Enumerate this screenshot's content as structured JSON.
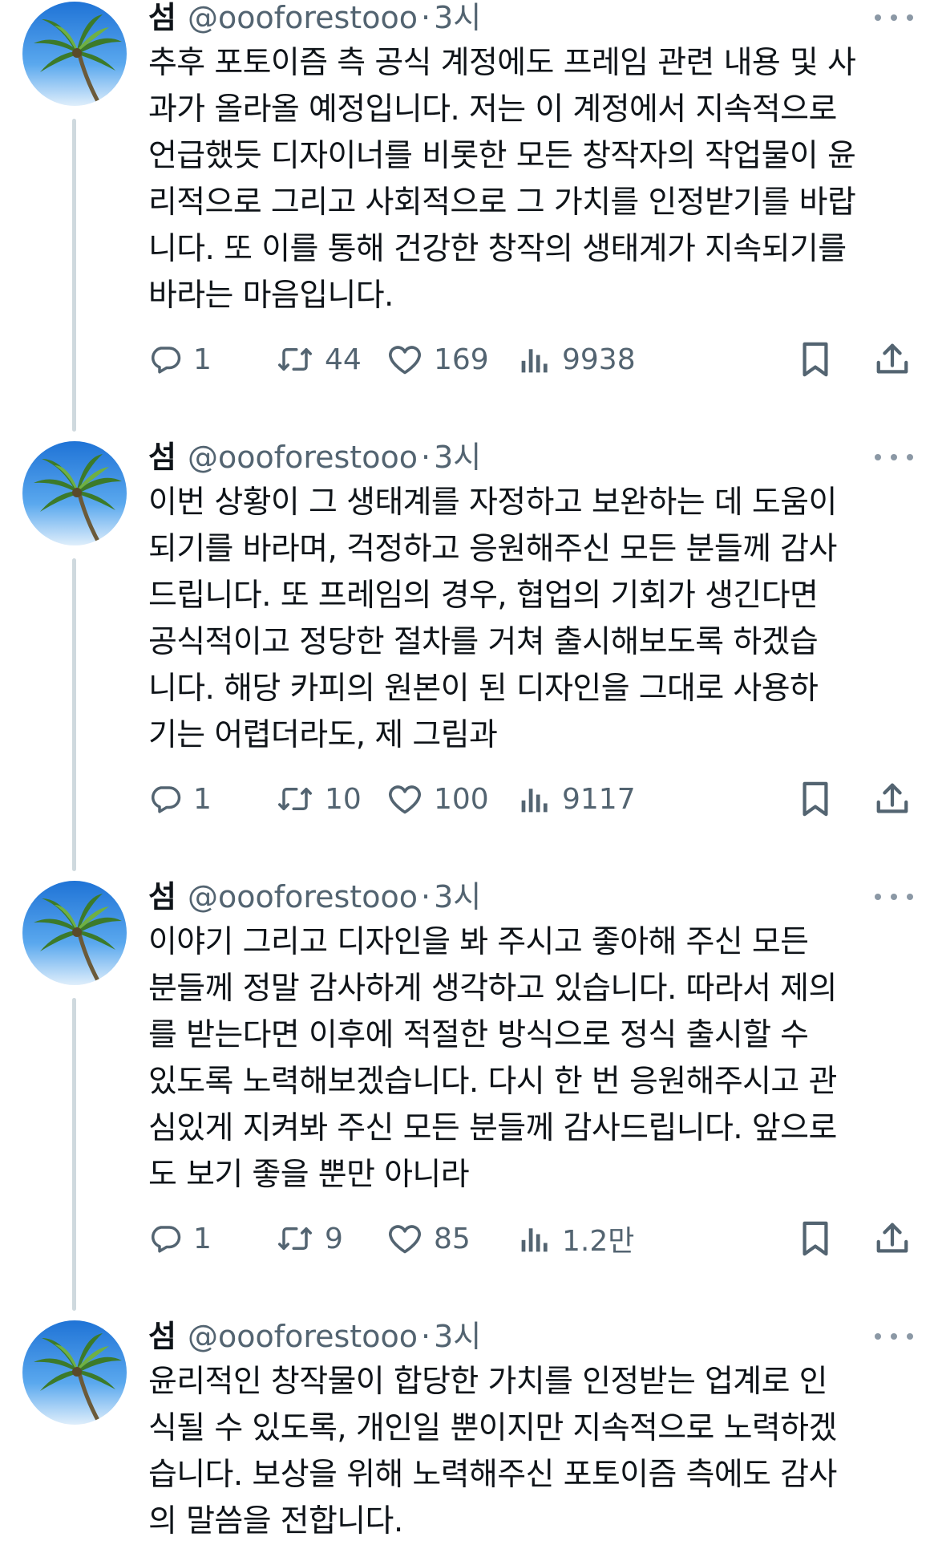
{
  "colors": {
    "text_primary": "#0f1419",
    "text_secondary": "#536471",
    "thread_line": "#cfd9de",
    "background": "#ffffff"
  },
  "icons": {
    "reply": "reply-icon",
    "retweet": "retweet-icon",
    "like": "heart-icon",
    "views": "bar-chart-icon",
    "bookmark": "bookmark-icon",
    "share": "share-icon",
    "more": "more-horizontal-icon",
    "avatar": "palm-tree-avatar"
  },
  "tweets": [
    {
      "author": {
        "name": "섬",
        "handle": "@oooforestooo"
      },
      "separator": "·",
      "time": "3시",
      "text": "추후 포토이즘 측 공식 계정에도 프레임 관련 내용 및 사\n과가 올라올 예정입니다. 저는 이 계정에서 지속적으로\n언급했듯 디자이너를 비롯한 모든 창작자의 작업물이 윤\n리적으로 그리고 사회적으로 그 가치를 인정받기를 바랍\n니다. 또 이를 통해 건강한 창작의 생태계가 지속되기를\n바라는 마음입니다.",
      "stats": {
        "replies": "1",
        "retweets": "44",
        "likes": "169",
        "views": "9938"
      }
    },
    {
      "author": {
        "name": "섬",
        "handle": "@oooforestooo"
      },
      "separator": "·",
      "time": "3시",
      "text": "이번 상황이 그 생태계를 자정하고 보완하는 데 도움이\n되기를 바라며, 걱정하고 응원해주신 모든 분들께 감사\n드립니다. 또 프레임의 경우, 협업의 기회가 생긴다면\n공식적이고 정당한 절차를 거쳐 출시해보도록 하겠습\n니다. 해당 카피의 원본이 된 디자인을 그대로 사용하\n기는 어렵더라도, 제 그림과",
      "stats": {
        "replies": "1",
        "retweets": "10",
        "likes": "100",
        "views": "9117"
      }
    },
    {
      "author": {
        "name": "섬",
        "handle": "@oooforestooo"
      },
      "separator": "·",
      "time": "3시",
      "text": "이야기 그리고 디자인을 봐 주시고 좋아해 주신 모든\n분들께 정말 감사하게 생각하고 있습니다. 따라서 제의\n를 받는다면 이후에 적절한 방식으로 정식 출시할 수\n있도록 노력해보겠습니다. 다시 한 번 응원해주시고 관\n심있게 지켜봐 주신 모든 분들께 감사드립니다. 앞으로\n도 보기 좋을 뿐만 아니라",
      "stats": {
        "replies": "1",
        "retweets": "9",
        "likes": "85",
        "views": "1.2만"
      }
    },
    {
      "author": {
        "name": "섬",
        "handle": "@oooforestooo"
      },
      "separator": "·",
      "time": "3시",
      "text": "윤리적인 창작물이 합당한 가치를 인정받는 업계로 인\n식될 수 있도록, 개인일 뿐이지만 지속적으로 노력하겠\n습니다. 보상을 위해 노력해주신 포토이즘 측에도 감사\n의 말씀을 전합니다."
    }
  ]
}
